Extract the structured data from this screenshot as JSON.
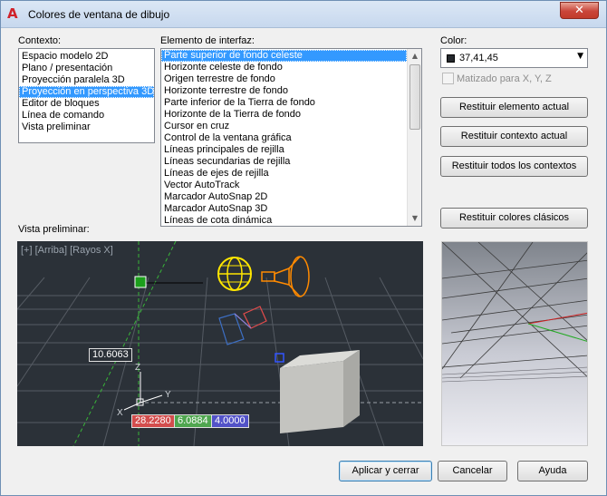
{
  "window": {
    "title": "Colores de ventana de dibujo",
    "close_glyph": "✕",
    "app_icon": "autocad-a-icon"
  },
  "context": {
    "label": "Contexto:",
    "items": [
      "Espacio modelo 2D",
      "Plano / presentación",
      "Proyección paralela 3D",
      "Proyección en perspectiva 3D",
      "Editor de bloques",
      "Línea de comando",
      "Vista preliminar"
    ],
    "selected_index": 3
  },
  "elements": {
    "label": "Elemento de interfaz:",
    "items": [
      "Parte superior de fondo celeste",
      "Horizonte celeste de fondo",
      "Origen terrestre de fondo",
      "Horizonte terrestre de fondo",
      "Parte inferior de la Tierra de fondo",
      "Horizonte de la Tierra de fondo",
      "Cursor en cruz",
      "Control de la ventana gráfica",
      "Líneas principales de rejilla",
      "Líneas secundarias de rejilla",
      "Líneas de ejes de rejilla",
      "Vector AutoTrack",
      "Marcador AutoSnap 2D",
      "Marcador AutoSnap 3D",
      "Líneas de cota dinámica"
    ],
    "selected_index": 0,
    "scroll_up": "▲",
    "scroll_down": "▼"
  },
  "color": {
    "label": "Color:",
    "value": "37,41,45",
    "swatch_color": "#25292d",
    "dropdown_arrow": "▼",
    "tint_label": "Matizado para X, Y, Z",
    "tint_checked": false
  },
  "buttons": {
    "restore_element": "Restituir elemento actual",
    "restore_context": "Restituir contexto actual",
    "restore_all": "Restituir todos los contextos",
    "restore_classic": "Restituir colores clásicos",
    "apply_close": "Aplicar y cerrar",
    "cancel": "Cancelar",
    "help": "Ayuda"
  },
  "preview": {
    "label": "Vista preliminar:",
    "viewport_label": "[+] [Arriba] [Rayos X]",
    "dim_main": "10.6063",
    "coord_x": "28.2280",
    "coord_y": "6.0884",
    "coord_z": "4.0000",
    "axis_x": "X",
    "axis_y": "Y",
    "axis_z": "Z",
    "colors": {
      "background": "#2b3138",
      "grid": "#5d646c",
      "coord_x_bg": "#d34d4d",
      "coord_y_bg": "#4fa64f",
      "coord_z_bg": "#5252c8",
      "autosnap": "#1c9e1c",
      "light_yellow": "#ffe600",
      "light_orange": "#ff8a00"
    }
  }
}
